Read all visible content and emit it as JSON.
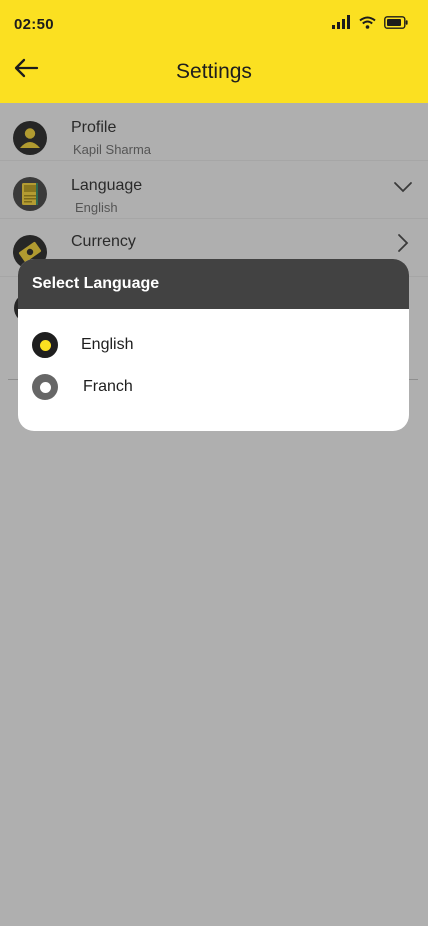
{
  "status_bar": {
    "time": "02:50",
    "icons": [
      "cellular-signal-icon",
      "wifi-icon",
      "battery-icon"
    ]
  },
  "header": {
    "title": "Settings",
    "back_icon": "arrow-left-icon",
    "background": "#fbe021"
  },
  "settings": {
    "profile": {
      "title": "Profile",
      "subtitle": "Kapil Sharma",
      "icon": "user-icon"
    },
    "language": {
      "title": "Language",
      "subtitle": "English",
      "icon": "dictionary-icon",
      "chevron": "chevron-down-icon"
    },
    "currency": {
      "title": "Currency",
      "icon": "money-icon",
      "chevron": "chevron-right-icon"
    }
  },
  "dialog": {
    "title": "Select Language",
    "options": [
      {
        "label": "English",
        "selected": true
      },
      {
        "label": "Franch",
        "selected": false
      }
    ],
    "accent": "#fbe021",
    "header_background": "#424242"
  },
  "overlay_color": "#afafaf"
}
